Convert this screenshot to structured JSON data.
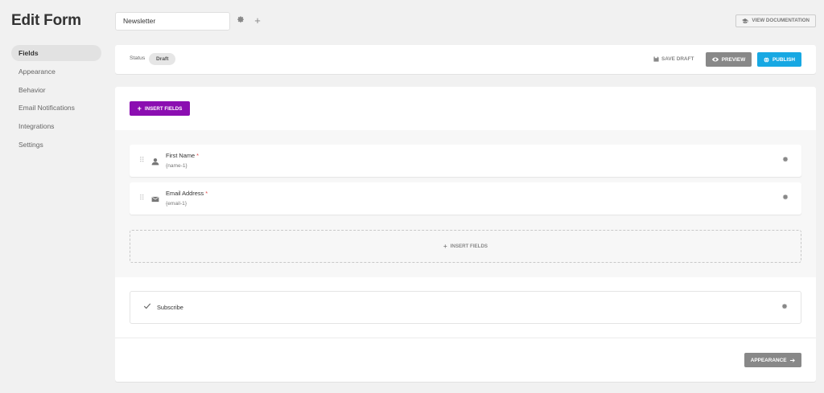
{
  "page_title": "Edit Form",
  "sidebar": {
    "items": [
      {
        "label": "Fields",
        "active": true
      },
      {
        "label": "Appearance"
      },
      {
        "label": "Behavior"
      },
      {
        "label": "Email Notifications"
      },
      {
        "label": "Integrations"
      },
      {
        "label": "Settings"
      }
    ]
  },
  "header": {
    "form_name": "Newsletter",
    "settings_icon": "gear-icon",
    "add_icon": "plus-icon",
    "view_docs_label": "VIEW DOCUMENTATION"
  },
  "statusbar": {
    "status_label": "Status",
    "status_value": "Draft",
    "save_draft_label": "SAVE DRAFT",
    "preview_label": "PREVIEW",
    "publish_label": "PUBLISH"
  },
  "main": {
    "insert_fields_label": "INSERT FIELDS",
    "fields": [
      {
        "name": "First Name",
        "id": "{name-1}",
        "icon": "person-icon",
        "required": "*"
      },
      {
        "name": "Email Address",
        "id": "{email-1}",
        "icon": "envelope-icon",
        "required": "*"
      }
    ],
    "insert_fields_dashed_label": "INSERT FIELDS",
    "submit_label": "Subscribe",
    "next_label": "APPEARANCE"
  },
  "colors": {
    "publish": "#17a8e3",
    "insert_fields": "#8b0eb1",
    "preview": "#888888",
    "required": "#e04848"
  }
}
